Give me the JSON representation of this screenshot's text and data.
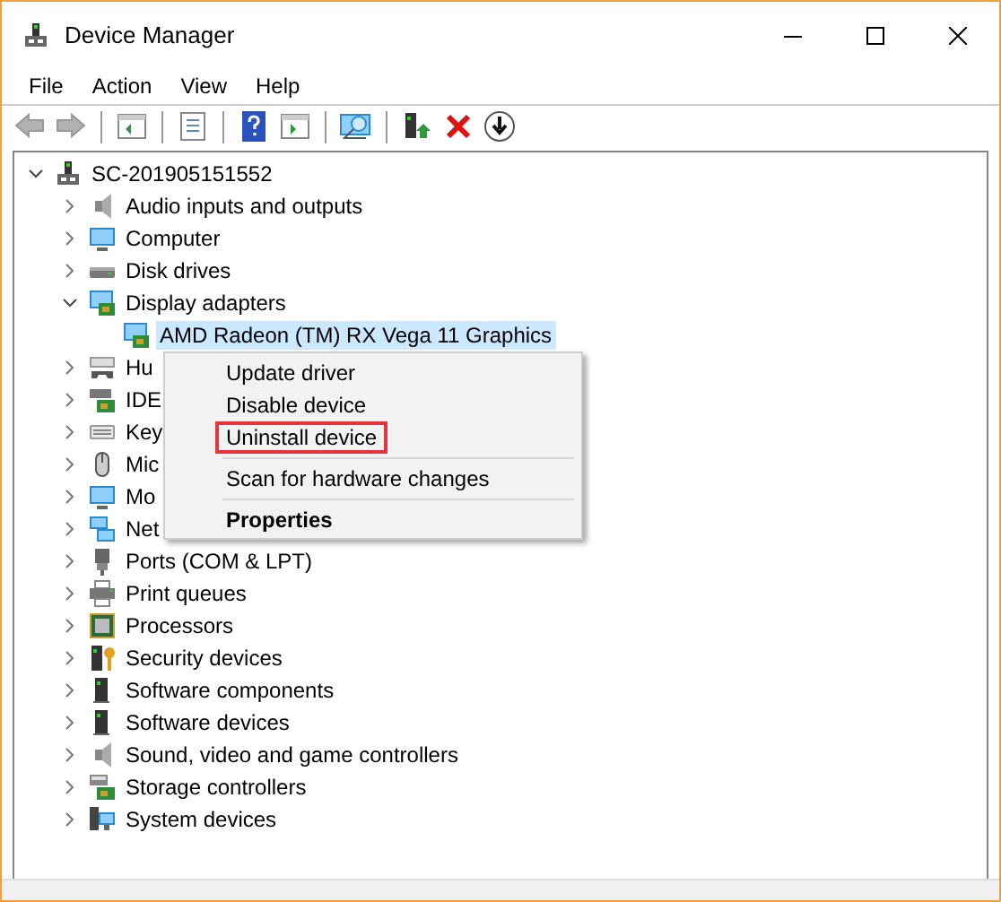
{
  "window": {
    "title": "Device Manager"
  },
  "menu_bar": [
    "File",
    "Action",
    "View",
    "Help"
  ],
  "toolbar": [
    {
      "kind": "back",
      "disabled": true
    },
    {
      "kind": "forward",
      "disabled": true
    },
    {
      "kind": "separator"
    },
    {
      "kind": "tree-pane",
      "disabled": false
    },
    {
      "kind": "separator"
    },
    {
      "kind": "properties",
      "disabled": false
    },
    {
      "kind": "separator"
    },
    {
      "kind": "help",
      "disabled": false
    },
    {
      "kind": "action-pane",
      "disabled": false
    },
    {
      "kind": "separator"
    },
    {
      "kind": "scan",
      "disabled": false
    },
    {
      "kind": "separator"
    },
    {
      "kind": "update",
      "disabled": false
    },
    {
      "kind": "uninstall",
      "disabled": false
    },
    {
      "kind": "enable",
      "disabled": false
    }
  ],
  "tree": {
    "label": "SC-201905151552",
    "kind": "computer",
    "expanded": true,
    "selected": false,
    "children": [
      {
        "label": "Audio inputs and outputs",
        "kind": "speaker",
        "expanded": false,
        "selected": false
      },
      {
        "label": "Computer",
        "kind": "monitor",
        "expanded": false,
        "selected": false
      },
      {
        "label": "Disk drives",
        "kind": "disk",
        "expanded": false,
        "selected": false
      },
      {
        "label": "Display adapters",
        "kind": "display",
        "expanded": true,
        "selected": false,
        "children": [
          {
            "label": "AMD Radeon (TM) RX Vega 11 Graphics",
            "kind": "display",
            "selected": true
          }
        ]
      },
      {
        "label": "Hu",
        "kind": "hid",
        "expanded": false,
        "selected": false
      },
      {
        "label": "IDE",
        "kind": "ide",
        "expanded": false,
        "selected": false
      },
      {
        "label": "Key",
        "kind": "keyboard",
        "expanded": false,
        "selected": false
      },
      {
        "label": "Mic",
        "kind": "mouse",
        "expanded": false,
        "selected": false
      },
      {
        "label": "Mo",
        "kind": "monitor",
        "expanded": false,
        "selected": false
      },
      {
        "label": "Net",
        "kind": "network",
        "expanded": false,
        "selected": false
      },
      {
        "label": "Ports (COM & LPT)",
        "kind": "port",
        "expanded": false,
        "selected": false
      },
      {
        "label": "Print queues",
        "kind": "printer",
        "expanded": false,
        "selected": false
      },
      {
        "label": "Processors",
        "kind": "chip",
        "expanded": false,
        "selected": false
      },
      {
        "label": "Security devices",
        "kind": "security",
        "expanded": false,
        "selected": false
      },
      {
        "label": "Software components",
        "kind": "tower",
        "expanded": false,
        "selected": false
      },
      {
        "label": "Software devices",
        "kind": "tower",
        "expanded": false,
        "selected": false
      },
      {
        "label": "Sound, video and game controllers",
        "kind": "speaker",
        "expanded": false,
        "selected": false
      },
      {
        "label": "Storage controllers",
        "kind": "storage",
        "expanded": false,
        "selected": false
      },
      {
        "label": "System devices",
        "kind": "system",
        "expanded": false,
        "selected": false
      }
    ]
  },
  "context_menu": {
    "items": [
      {
        "kind": "item",
        "label": "Update driver",
        "highlighted": false
      },
      {
        "kind": "item",
        "label": "Disable device",
        "highlighted": false
      },
      {
        "kind": "item",
        "label": "Uninstall device",
        "highlighted": true
      },
      {
        "kind": "separator"
      },
      {
        "kind": "item",
        "label": "Scan for hardware changes",
        "highlighted": false
      },
      {
        "kind": "separator"
      },
      {
        "kind": "default",
        "label": "Properties",
        "highlighted": false
      }
    ]
  }
}
